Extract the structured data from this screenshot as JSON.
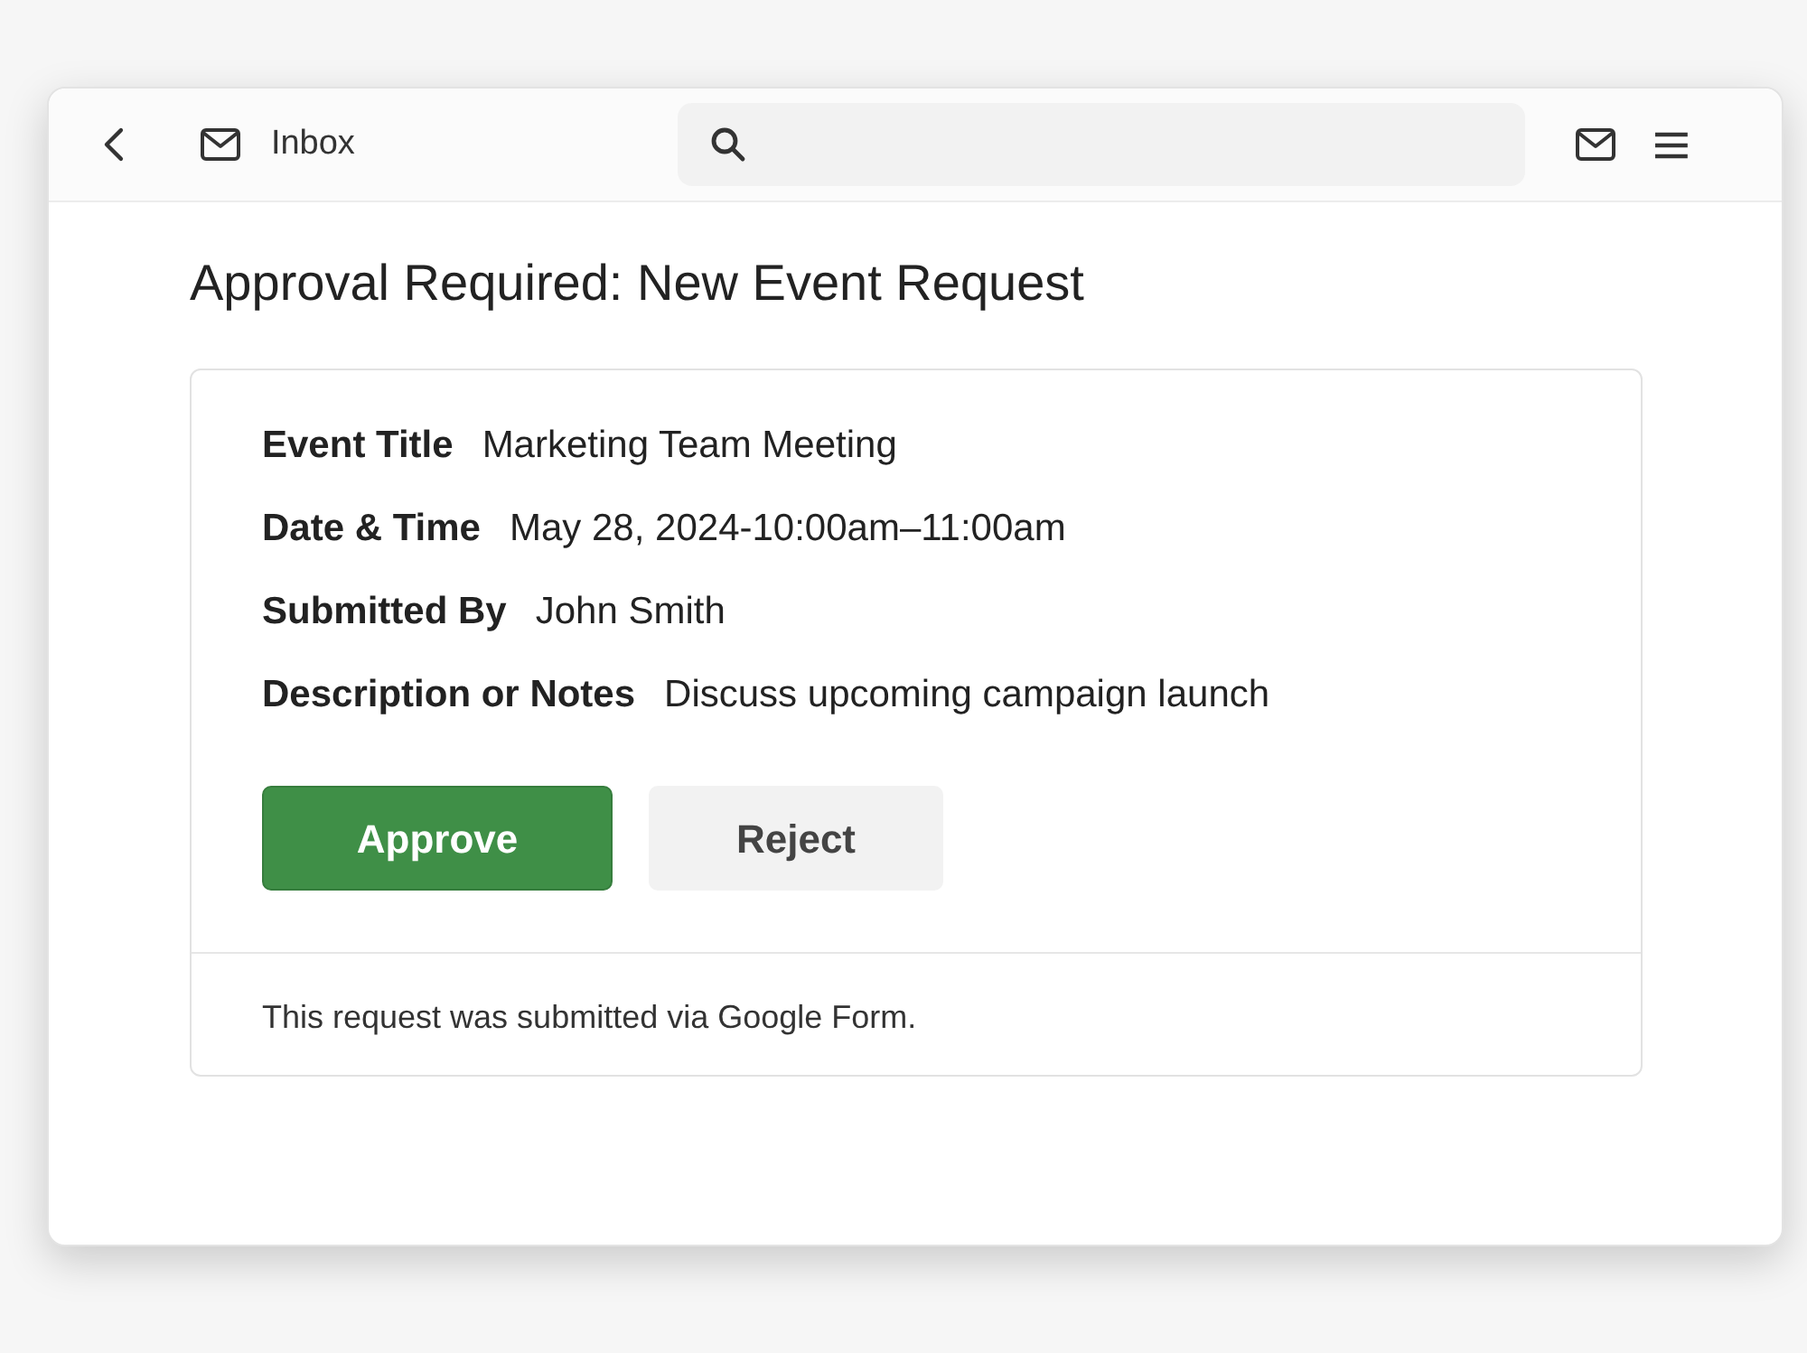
{
  "header": {
    "folder_label": "Inbox"
  },
  "email": {
    "subject": "Approval Required: New Event Request",
    "fields": [
      {
        "label": "Event Title",
        "value": "Marketing Team Meeting"
      },
      {
        "label": "Date & Time",
        "value": "May 28, 2024-10:00am–11:00am"
      },
      {
        "label": "Submitted By",
        "value": "John Smith"
      },
      {
        "label": "Description or Notes",
        "value": "Discuss upcoming campaign launch"
      }
    ],
    "actions": [
      {
        "label": "Approve",
        "kind": "primary"
      },
      {
        "label": "Reject",
        "kind": "secondary"
      }
    ],
    "footer": "This request was submitted via Google Form."
  }
}
